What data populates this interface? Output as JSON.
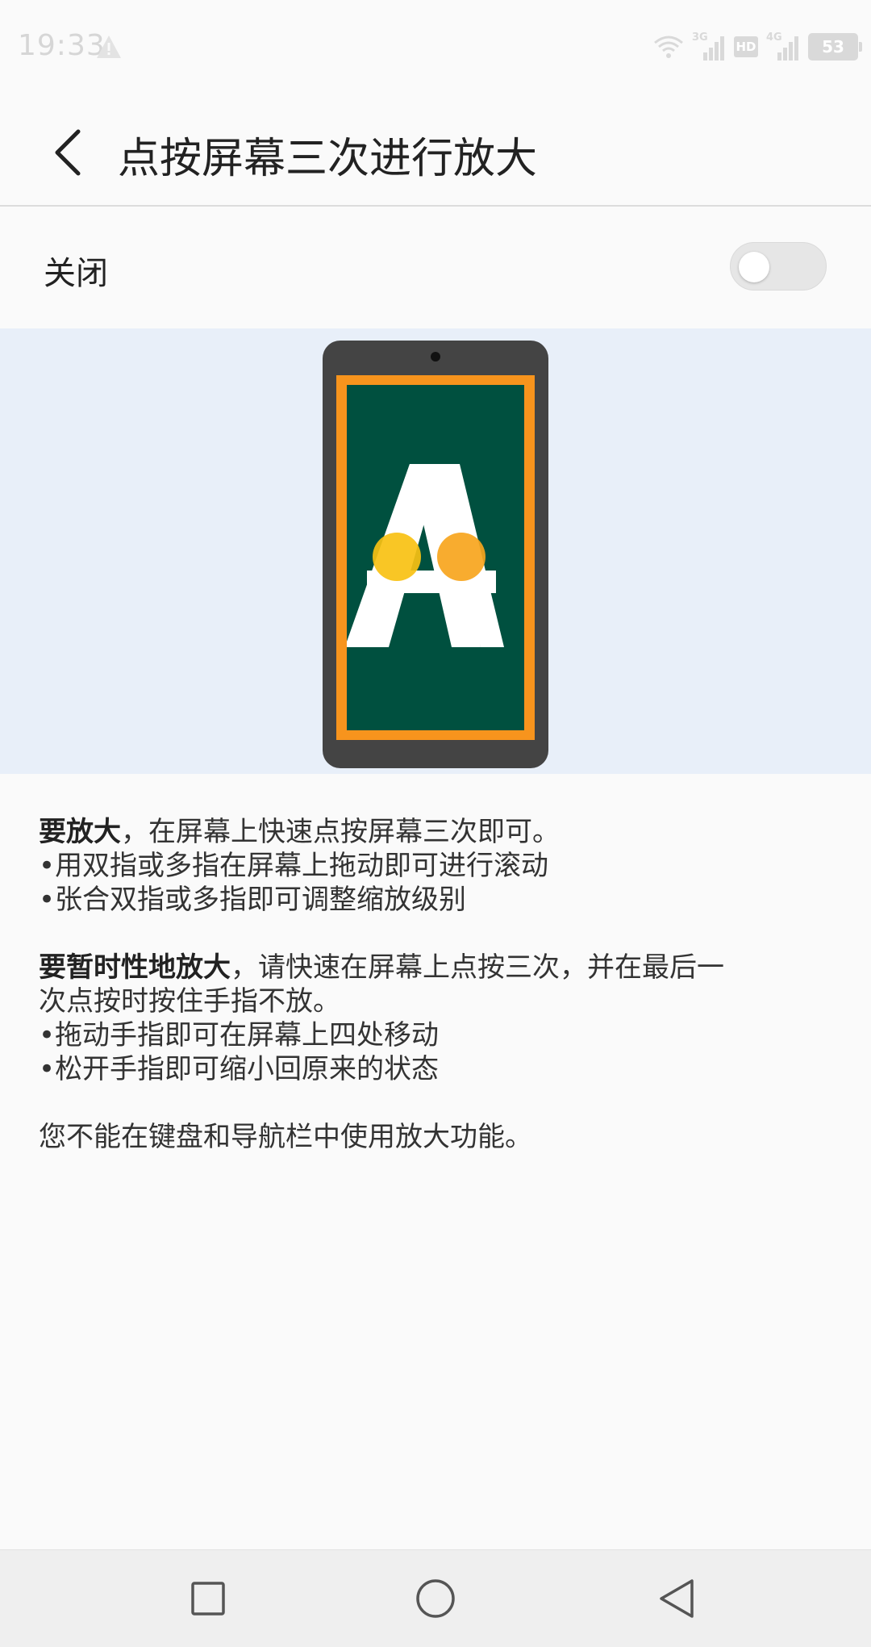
{
  "status_bar": {
    "time": "19:33",
    "network_3g": "3G",
    "network_4g": "4G",
    "hd": "HD",
    "battery": "53"
  },
  "header": {
    "title": "点按屏幕三次进行放大"
  },
  "toggle": {
    "label": "关闭",
    "state": "off"
  },
  "illustration": {
    "letter": "A",
    "colors": {
      "background": "#e8eff9",
      "phone_body": "#444444",
      "frame": "#f7941d",
      "screen": "#00503f",
      "letter": "#ffffff",
      "touch_dot": "#f9c112"
    }
  },
  "description": {
    "p1": {
      "bold": "要放大",
      "rest": "，在屏幕上快速点按屏幕三次即可。",
      "bullets": [
        "用双指或多指在屏幕上拖动即可进行滚动",
        "张合双指或多指即可调整缩放级别"
      ]
    },
    "p2": {
      "bold": "要暂时性地放大",
      "rest_line1": "，请快速在屏幕上点按三次，并在最后一",
      "rest_line2": "次点按时按住手指不放。",
      "bullets": [
        "拖动手指即可在屏幕上四处移动",
        "松开手指即可缩小回原来的状态"
      ]
    },
    "p3": "您不能在键盘和导航栏中使用放大功能。",
    "bullet_char": "•"
  },
  "nav": {
    "icons": [
      "recent-apps-icon",
      "home-icon",
      "back-triangle-icon"
    ]
  }
}
